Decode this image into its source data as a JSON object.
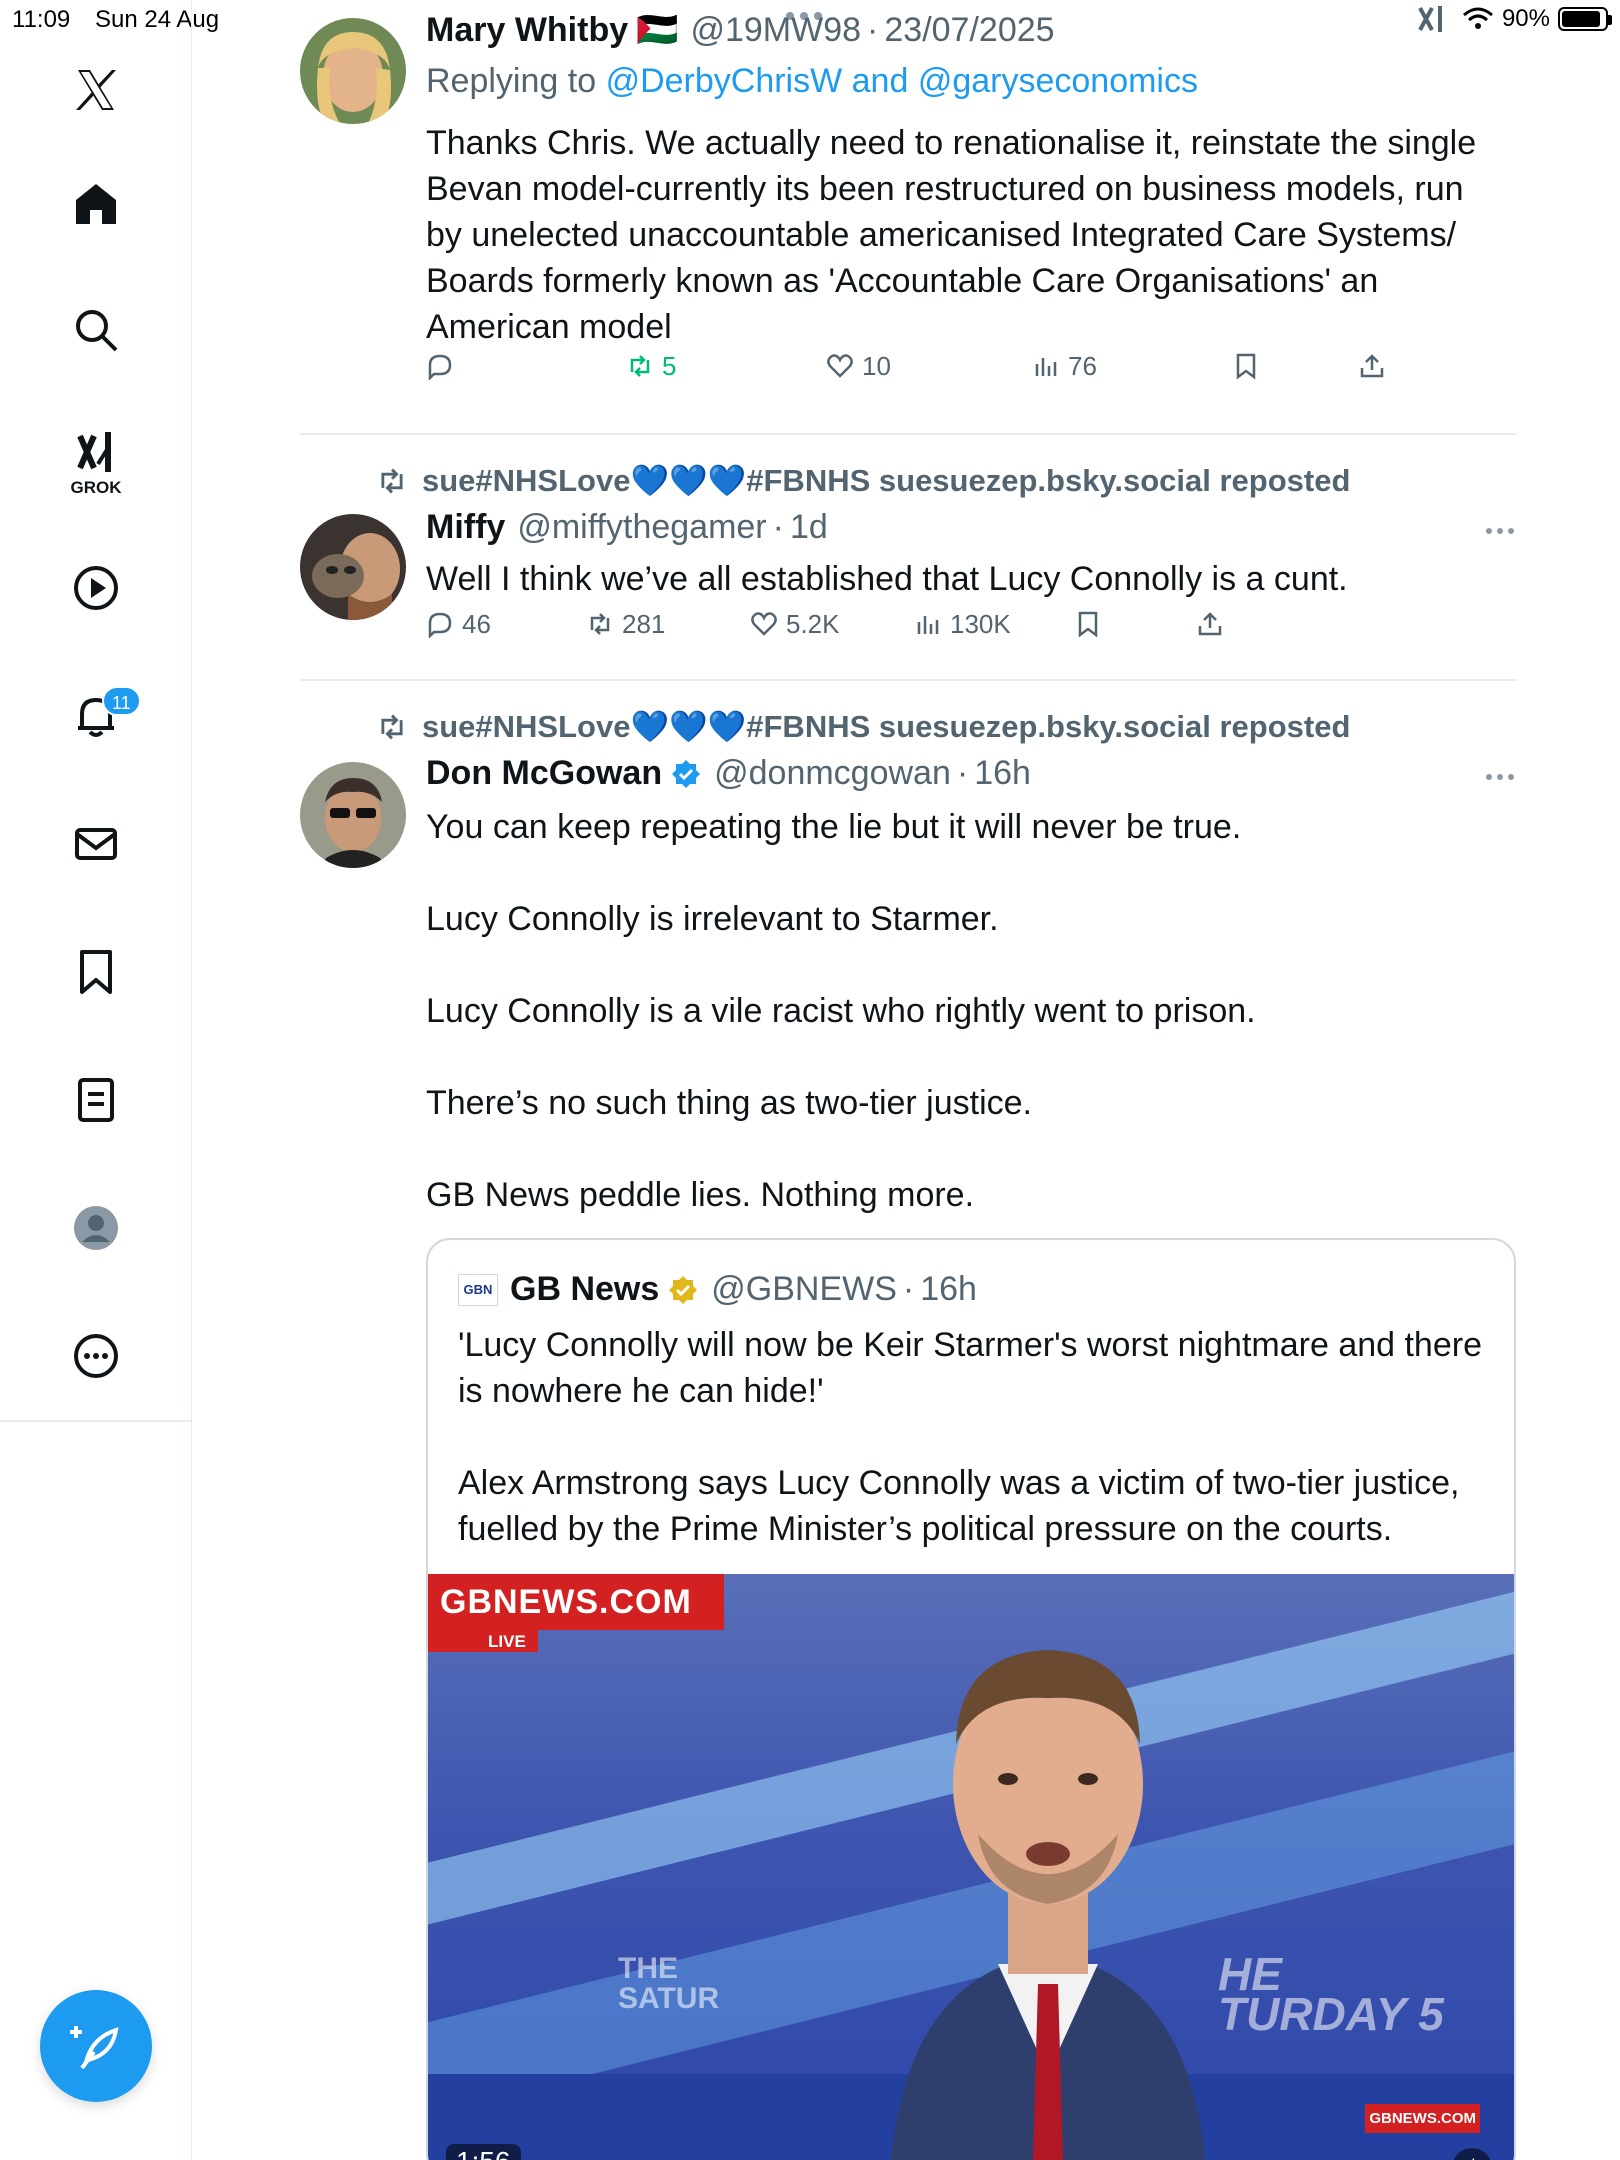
{
  "status_bar": {
    "time": "11:09",
    "date": "Sun 24 Aug",
    "battery": "90%",
    "battery_level": 0.9
  },
  "sidebar": {
    "items": [
      {
        "name": "home",
        "icon": "home-icon"
      },
      {
        "name": "search",
        "icon": "search-icon"
      },
      {
        "name": "grok",
        "icon": "grok-icon",
        "label": "GROK"
      },
      {
        "name": "video",
        "icon": "play-icon"
      },
      {
        "name": "notifications",
        "icon": "bell-icon",
        "badge": "11"
      },
      {
        "name": "messages",
        "icon": "mail-icon"
      },
      {
        "name": "bookmarks",
        "icon": "bookmark-icon"
      },
      {
        "name": "lists",
        "icon": "list-icon"
      },
      {
        "name": "profile",
        "icon": "profile-icon"
      },
      {
        "name": "more",
        "icon": "more-icon"
      }
    ],
    "compose_icon": "compose-icon"
  },
  "tweets": [
    {
      "name": "Mary Whitby",
      "flag": "🇵🇸",
      "handle": "@19MW98",
      "time": "23/07/2025",
      "reply_prefix": "Replying to",
      "reply_to": "@DerbyChrisW and @garyseconomics",
      "body": "Thanks Chris. We actually need to renationalise it, reinstate the single Bevan model-currently its been restructured on business models, run by unelected unaccountable americanised Integrated Care Systems/ Boards formerly known as 'Accountable Care Organisations' an American model",
      "stats": {
        "replies": "",
        "reposts": "5",
        "likes": "10",
        "views": "76"
      }
    },
    {
      "repost_by": "sue#NHSLove💙💙💙#FBNHS suesuezep.bsky.social reposted",
      "name": "Miffy",
      "handle": "@miffythegamer",
      "time": "1d",
      "body": "Well I think we’ve all established that Lucy Connolly is a cunt.",
      "stats": {
        "replies": "46",
        "reposts": "281",
        "likes": "5.2K",
        "views": "130K"
      }
    },
    {
      "repost_by": "sue#NHSLove💙💙💙#FBNHS suesuezep.bsky.social reposted",
      "name": "Don McGowan",
      "handle": "@donmcgowan",
      "time": "16h",
      "verified": "blue",
      "body": [
        "You can keep repeating the lie but it will never be true.",
        "Lucy Connolly is irrelevant to Starmer.",
        "Lucy Connolly is a vile racist who rightly went to prison.",
        "There’s no such thing as two-tier justice.",
        "GB News peddle lies. Nothing more."
      ],
      "quote": {
        "logo": "GBN",
        "name": "GB News",
        "verified": "gold",
        "handle": "@GBNEWS",
        "time": "16h",
        "body": [
          "'Lucy Connolly will now be Keir Starmer's worst nightmare and there is nowhere he can hide!'",
          "Alex Armstrong says Lucy Connolly was a victim of two-tier justice, fuelled by the Prime Minister’s political pressure on the courts."
        ],
        "video": {
          "banner": "GBNEWS.COM",
          "live": "LIVE",
          "watermark_left": "THE SATUR",
          "watermark_right": "HE TURDAY 5",
          "corner": "GBNEWS.COM",
          "duration": "1:56"
        }
      }
    }
  ]
}
